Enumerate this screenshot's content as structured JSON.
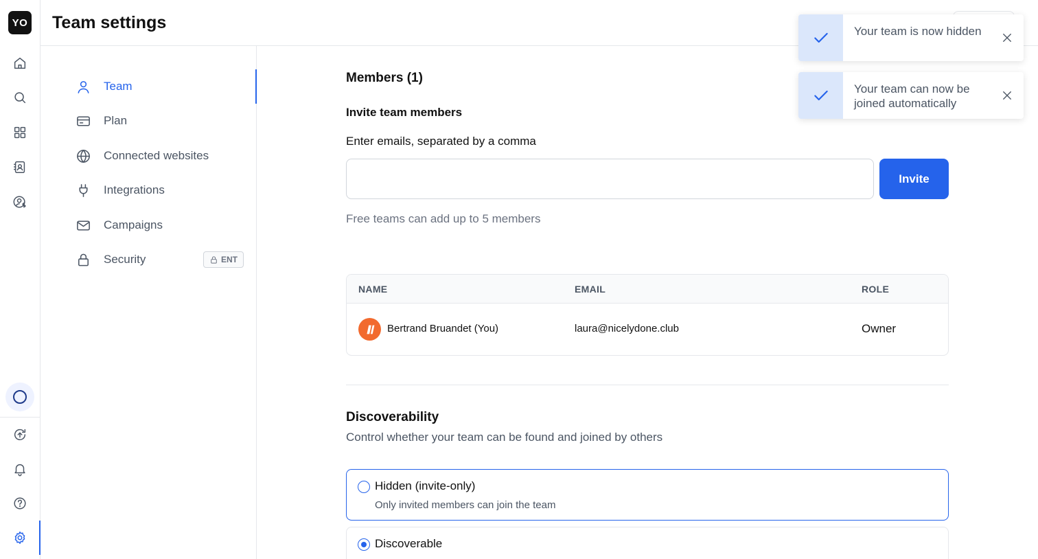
{
  "app": {
    "logo_text": "YO"
  },
  "rail": {
    "top_icons": [
      "home-icon",
      "search-icon",
      "grid-icon",
      "contacts-icon",
      "billing-user-icon"
    ],
    "bottom_icons": [
      "upload-icon",
      "bell-icon",
      "help-icon",
      "settings-icon"
    ],
    "active": "settings-icon"
  },
  "header": {
    "title": "Team settings"
  },
  "settings_nav": {
    "items": [
      {
        "label": "Team",
        "icon": "user-icon",
        "active": true
      },
      {
        "label": "Plan",
        "icon": "card-icon",
        "active": false
      },
      {
        "label": "Connected websites",
        "icon": "globe-icon",
        "active": false
      },
      {
        "label": "Integrations",
        "icon": "plug-icon",
        "active": false
      },
      {
        "label": "Campaigns",
        "icon": "mail-icon",
        "active": false
      },
      {
        "label": "Security",
        "icon": "lock-icon",
        "active": false,
        "badge": "ENT"
      }
    ]
  },
  "members": {
    "title": "Members (1)",
    "invite_title": "Invite team members",
    "emails_label": "Enter emails, separated by a comma",
    "email_value": "",
    "invite_button": "Invite",
    "limit_note": "Free teams can add up to 5 members",
    "table": {
      "headers": {
        "name": "NAME",
        "email": "EMAIL",
        "role": "ROLE"
      },
      "rows": [
        {
          "name": "Bertrand Bruandet (You)",
          "email": "laura@nicelydone.club",
          "role": "Owner"
        }
      ]
    }
  },
  "discoverability": {
    "title": "Discoverability",
    "subtitle": "Control whether your team can be found and joined by others",
    "options": [
      {
        "label": "Hidden (invite-only)",
        "description": "Only invited members can join the team",
        "checked": false
      },
      {
        "label": "Discoverable",
        "description": "",
        "checked": true
      }
    ]
  },
  "toasts": [
    {
      "message": "Your team is now hidden"
    },
    {
      "message": "Your team can now be joined automatically"
    }
  ],
  "colors": {
    "accent": "#2563eb",
    "avatar": "#f26a2e",
    "toast_check_bg": "#dbe7fb"
  }
}
